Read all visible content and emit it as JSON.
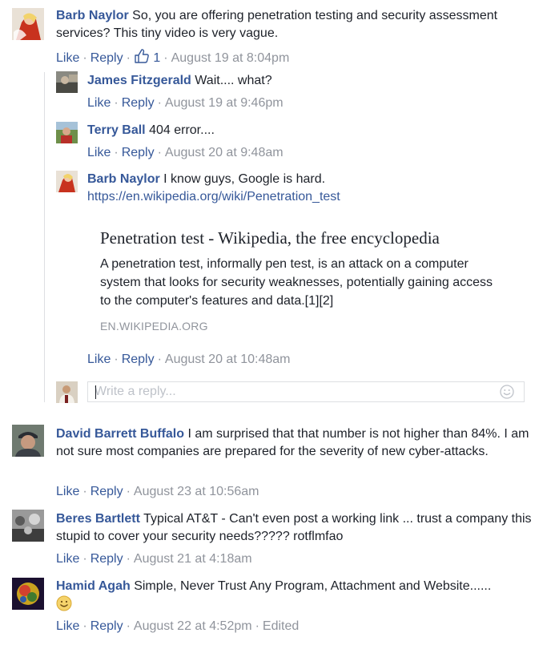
{
  "actions": {
    "like": "Like",
    "reply": "Reply",
    "sep": "·"
  },
  "comments": [
    {
      "author": "Barb Naylor",
      "text": "So, you are offering penetration testing and security assessment services? This tiny video is very vague.",
      "likes": "1",
      "timestamp": "August 19 at 8:04pm",
      "replies": [
        {
          "author": "James Fitzgerald",
          "text": "Wait.... what?",
          "timestamp": "August 19 at 9:46pm"
        },
        {
          "author": "Terry Ball",
          "text": "404 error....",
          "timestamp": "August 20 at 9:48am"
        },
        {
          "author": "Barb Naylor",
          "text": "I know guys, Google is hard.",
          "link": "https://en.wikipedia.org/wiki/Penetration_test",
          "preview": {
            "title": "Penetration test - Wikipedia, the free encyclopedia",
            "description": "A penetration test, informally pen test, is an attack on a computer system that looks for security weaknesses, potentially gaining access to the computer's features and data.[1][2]",
            "domain": "EN.WIKIPEDIA.ORG"
          },
          "timestamp": "August 20 at 10:48am"
        }
      ],
      "reply_placeholder": "Write a reply..."
    },
    {
      "author": "David Barrett Buffalo",
      "text": "I am surprised that that number is not higher than 84%. I am not sure most companies are prepared for the severity of new cyber-attacks.",
      "timestamp": "August 23 at 10:56am"
    },
    {
      "author": "Beres Bartlett",
      "text": "Typical AT&T - Can't even post a working link ... trust a company this stupid to cover your security needs????? rotflmfao",
      "timestamp": "August 21 at 4:18am"
    },
    {
      "author": "Hamid Agah",
      "text": "Simple, Never Trust Any Program, Attachment and Website......",
      "timestamp": "August 22 at 4:52pm",
      "edited": "Edited"
    }
  ],
  "colors": {
    "name": "#365899",
    "meta": "#90949c",
    "text": "#1d2129",
    "border": "#dddfe2"
  },
  "icons": [
    "like-thumb-icon",
    "emoji-icon",
    "smiley-emoji-icon"
  ]
}
